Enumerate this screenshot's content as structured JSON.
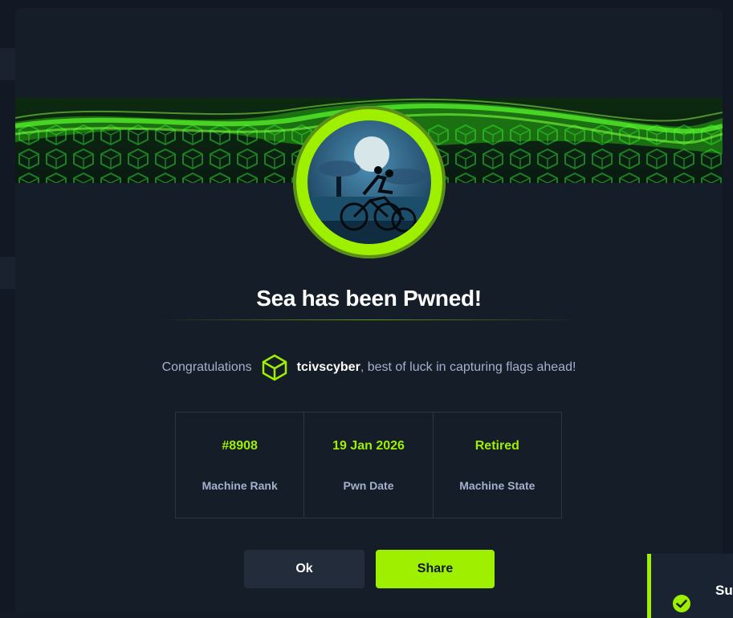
{
  "modal": {
    "title": "Sea has been Pwned!",
    "congrats_prefix": "Congratulations",
    "username": "tcivscyber",
    "congrats_suffix": ", best of luck in capturing flags ahead!",
    "stats": [
      {
        "value": "#8908",
        "label": "Machine Rank"
      },
      {
        "value": "19 Jan 2026",
        "label": "Pwn Date"
      },
      {
        "value": "Retired",
        "label": "Machine State"
      }
    ],
    "ok_label": "Ok",
    "share_label": "Share"
  },
  "toast": {
    "text": "Suc",
    "icon": "check-circle-icon"
  },
  "colors": {
    "accent": "#9fef00",
    "background": "#151d29",
    "muted_text": "#a4b1cd"
  }
}
